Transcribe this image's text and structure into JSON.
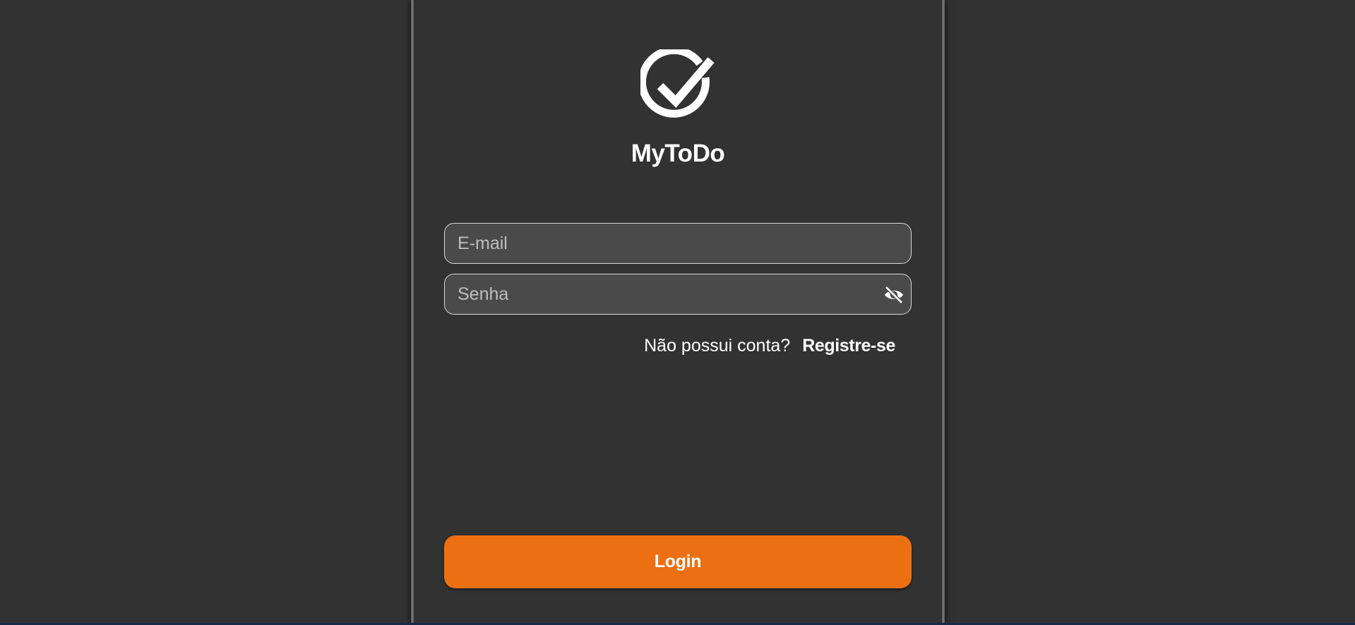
{
  "app": {
    "title": "MyToDo",
    "logo_icon": "check-circle-icon"
  },
  "form": {
    "email_placeholder": "E-mail",
    "email_value": "",
    "password_placeholder": "Senha",
    "password_value": "",
    "password_toggle_icon": "eye-off-icon"
  },
  "register": {
    "prompt": "Não possui conta?",
    "link_label": "Registre-se"
  },
  "actions": {
    "login_label": "Login"
  },
  "colors": {
    "background": "#323232",
    "input_background": "#4a4a4a",
    "accent": "#ec7012",
    "text": "#ffffff"
  }
}
